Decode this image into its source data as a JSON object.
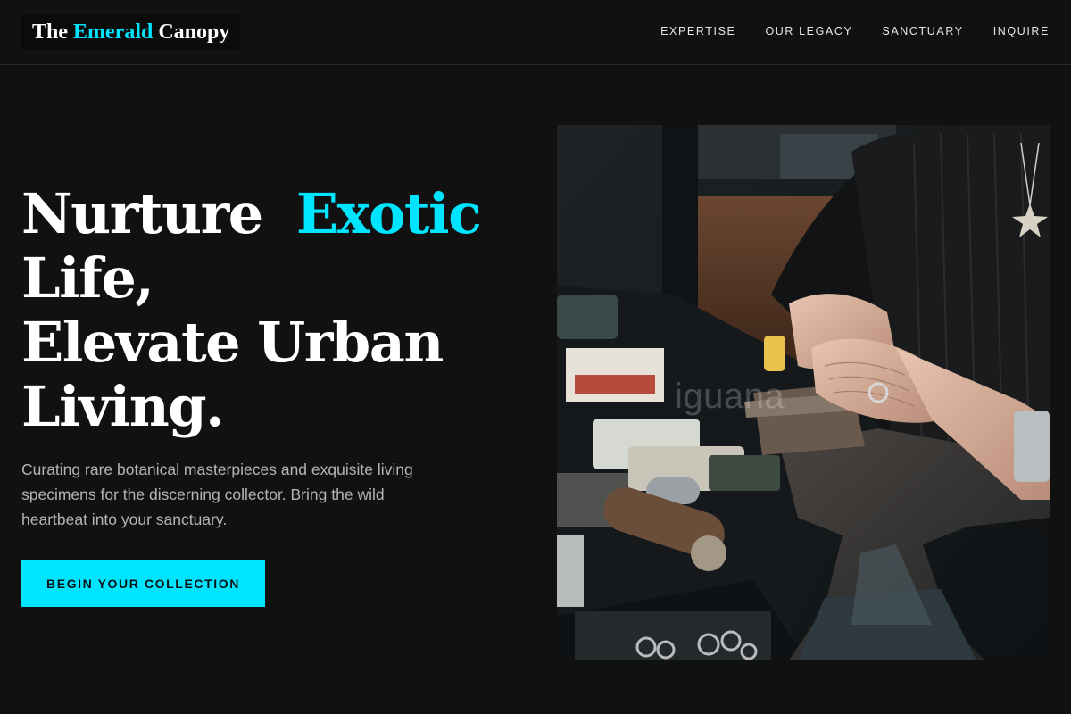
{
  "brand": {
    "part1": "The ",
    "accent": "Emerald",
    "part2": " Canopy"
  },
  "nav": [
    {
      "label": "EXPERTISE"
    },
    {
      "label": "OUR LEGACY"
    },
    {
      "label": "SANCTUARY"
    },
    {
      "label": "INQUIRE"
    }
  ],
  "hero": {
    "headline": {
      "l1a": "Nurture ",
      "l1b": "Exotic",
      "l2": "Life,",
      "l3": "Elevate Urban",
      "l4": "Living."
    },
    "subtext": "Curating rare botanical masterpieces and exquisite living specimens for the discerning collector. Bring the wild heartbeat into your sanctuary.",
    "cta_label": "BEGIN YOUR COLLECTION",
    "image_watermark": "iguana"
  },
  "colors": {
    "accent": "#00e5ff",
    "background": "#111112",
    "text": "#ffffff",
    "muted_text": "#b3b3b8"
  }
}
